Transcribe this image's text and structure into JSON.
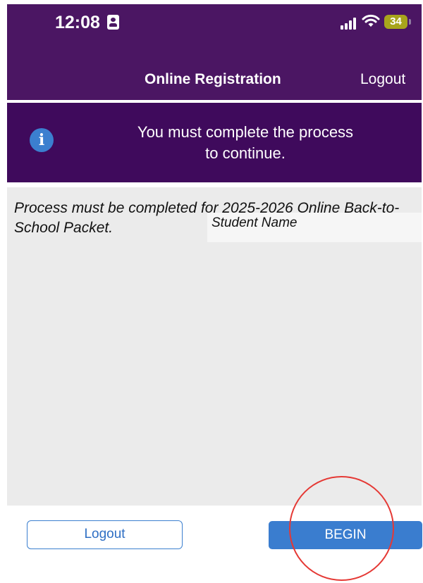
{
  "status_bar": {
    "time": "12:08",
    "battery": "34",
    "icons": [
      "contact-card-icon",
      "signal-icon",
      "wifi-icon",
      "battery-icon"
    ]
  },
  "nav": {
    "title": "Online Registration",
    "logout_label": "Logout"
  },
  "banner": {
    "icon": "info-icon",
    "icon_glyph": "i",
    "message": "You must complete the process\nto continue."
  },
  "content": {
    "process_text": "Process must be completed for 2025-2026 Online Back-to-School Packet.",
    "student_name": "Student Name"
  },
  "actions": {
    "logout_label": "Logout",
    "begin_label": "BEGIN"
  },
  "colors": {
    "header_bg": "#4b1663",
    "banner_bg": "#3f0a5c",
    "accent_blue": "#3a7dcf",
    "content_bg": "#ebebeb",
    "highlight": "#e53935"
  }
}
